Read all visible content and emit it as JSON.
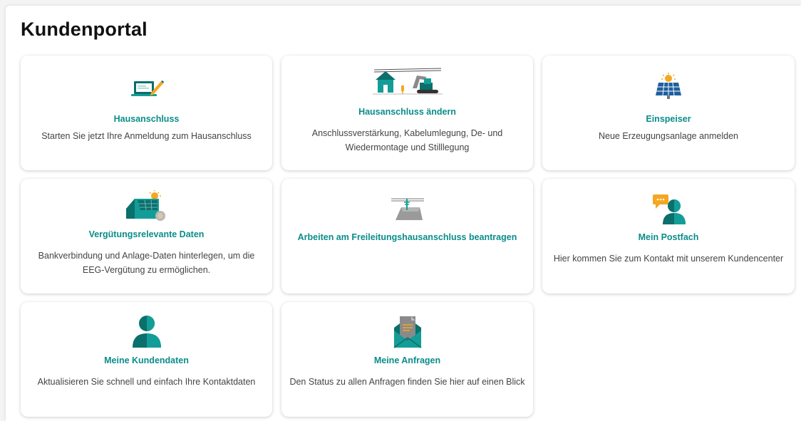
{
  "page": {
    "title": "Kundenportal"
  },
  "tiles": [
    {
      "title": "Hausanschluss",
      "description": "Starten Sie jetzt Ihre Anmeldung zum Hausanschluss",
      "icon": "laptop-pencil-icon"
    },
    {
      "title": "Hausanschluss ändern",
      "description": "Anschlussverstärkung, Kabelumlegung, De- und Wiedermontage und Stilllegung",
      "icon": "house-excavator-icon"
    },
    {
      "title": "Einspeiser",
      "description": "Neue Erzeugungsanlage anmelden",
      "icon": "solar-panel-icon"
    },
    {
      "title": "Vergütungsrelevante Daten",
      "description": "Bankverbindung und Anlage-Daten hinterlegen, um die EEG-Vergütung zu ermöglichen.",
      "icon": "solar-roof-icon"
    },
    {
      "title": "Arbeiten am Freileitungshausanschluss beantragen",
      "description": "",
      "icon": "overhead-line-icon"
    },
    {
      "title": "Mein Postfach",
      "description": "Hier kommen Sie zum Kontakt mit unserem Kundencenter",
      "icon": "person-chat-icon"
    },
    {
      "title": "Meine Kundendaten",
      "description": "Aktualisieren Sie schnell und einfach Ihre Kontaktdaten",
      "icon": "person-icon"
    },
    {
      "title": "Meine Anfragen",
      "description": "Den Status zu allen Anfragen finden Sie hier auf einen Blick",
      "icon": "envelope-document-icon"
    }
  ],
  "colors": {
    "accent": "#0a8d8a",
    "icon_dark": "#0b6f6c",
    "icon_mid": "#139d98",
    "sun": "#f5a623",
    "gray": "#9a9a9a"
  }
}
